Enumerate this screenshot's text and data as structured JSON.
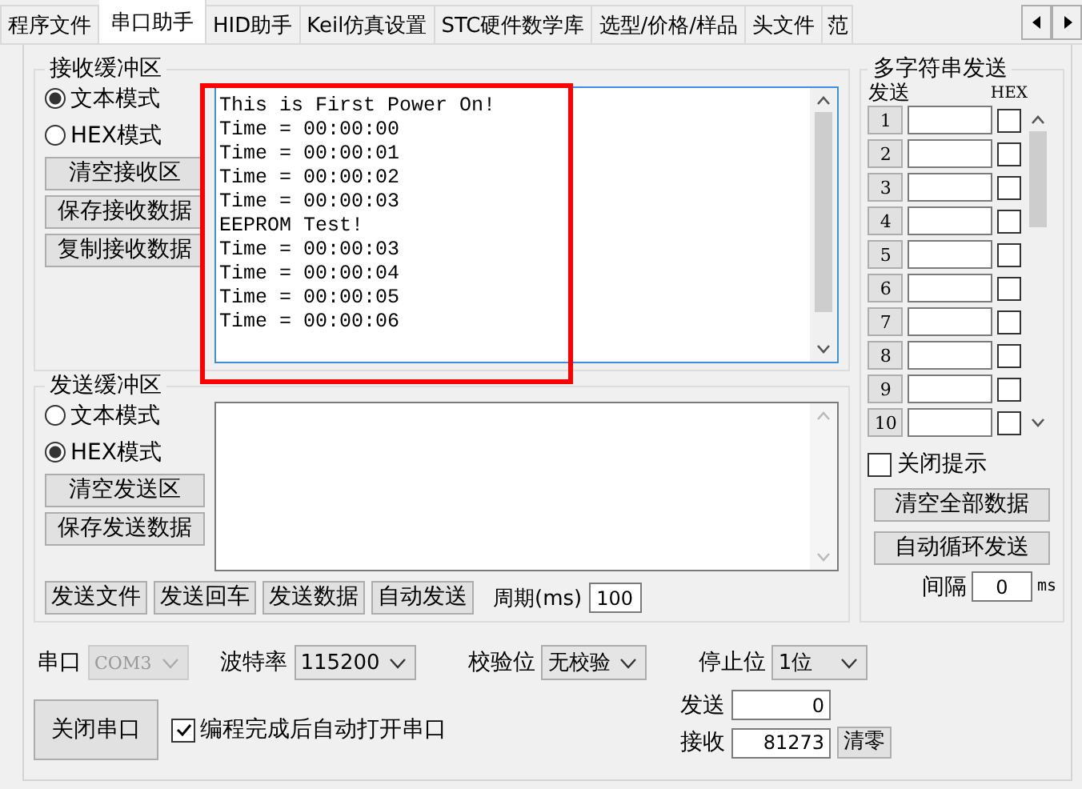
{
  "tabs": [
    {
      "label": "程序文件",
      "selected": false
    },
    {
      "label": "串口助手",
      "selected": true
    },
    {
      "label": "HID助手",
      "selected": false
    },
    {
      "label": "Keil仿真设置",
      "selected": false
    },
    {
      "label": "STC硬件数学库",
      "selected": false
    },
    {
      "label": "选型/价格/样品",
      "selected": false
    },
    {
      "label": "头文件",
      "selected": false
    },
    {
      "label": "范",
      "selected": false
    }
  ],
  "receive": {
    "title": "接收缓冲区",
    "modes": [
      {
        "label": "文本模式",
        "selected": true
      },
      {
        "label": "HEX模式",
        "selected": false
      }
    ],
    "buttons": [
      "清空接收区",
      "保存接收数据",
      "复制接收数据"
    ],
    "lines": [
      "This is First Power On!",
      "Time = 00:00:00",
      "Time = 00:00:01",
      "Time = 00:00:02",
      "Time = 00:00:03",
      "EEPROM Test!",
      "Time = 00:00:03",
      "Time = 00:00:04",
      "Time = 00:00:05",
      "Time = 00:00:06"
    ]
  },
  "send": {
    "title": "发送缓冲区",
    "modes": [
      {
        "label": "文本模式",
        "selected": false
      },
      {
        "label": "HEX模式",
        "selected": true
      }
    ],
    "buttons": [
      "清空发送区",
      "保存发送数据"
    ],
    "actions": [
      "发送文件",
      "发送回车",
      "发送数据",
      "自动发送"
    ],
    "period_label": "周期(ms)",
    "period_value": "100"
  },
  "multi": {
    "title": "多字符串发送",
    "send_header": "发送",
    "hex_header": "HEX",
    "rows": [
      {
        "number": "1",
        "hex": false
      },
      {
        "number": "2",
        "hex": false
      },
      {
        "number": "3",
        "hex": false
      },
      {
        "number": "4",
        "hex": false
      },
      {
        "number": "5",
        "hex": false
      },
      {
        "number": "6",
        "hex": false
      },
      {
        "number": "7",
        "hex": false
      },
      {
        "number": "8",
        "hex": false
      },
      {
        "number": "9",
        "hex": false
      },
      {
        "number": "10",
        "hex": false
      }
    ],
    "close_tip": {
      "label": "关闭提示",
      "checked": false
    },
    "buttons": [
      "清空全部数据",
      "自动循环发送"
    ],
    "interval_label": "间隔",
    "interval_value": "0",
    "interval_unit": "ms"
  },
  "settings": [
    {
      "label": "串口",
      "value": "COM3",
      "disabled": true
    },
    {
      "label": "波特率",
      "value": "115200",
      "disabled": false
    },
    {
      "label": "校验位",
      "value": "无校验",
      "disabled": false
    },
    {
      "label": "停止位",
      "value": "1位",
      "disabled": false
    }
  ],
  "close_button": "关闭串口",
  "auto_open": {
    "label": "编程完成后自动打开串口",
    "checked": true
  },
  "counters": {
    "sent_label": "发送",
    "sent_value": "0",
    "received_label": "接收",
    "received_value": "81273",
    "clear_button": "清零"
  }
}
